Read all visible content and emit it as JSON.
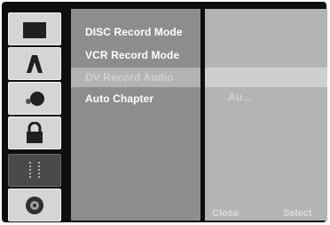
{
  "menu": {
    "items": [
      {
        "label": "DISC Record Mode"
      },
      {
        "label": "VCR Record Mode"
      },
      {
        "label": "DV Record Audio"
      },
      {
        "label": "Auto Chapter"
      }
    ]
  },
  "panel": {
    "value": "Au...",
    "hint_left": "Close",
    "hint_right": "Select"
  },
  "sidebar": {
    "icons": [
      "folder-icon",
      "a-letter-icon",
      "record-dot-icon",
      "lock-icon",
      "sliders-icon",
      "disc-icon"
    ]
  }
}
